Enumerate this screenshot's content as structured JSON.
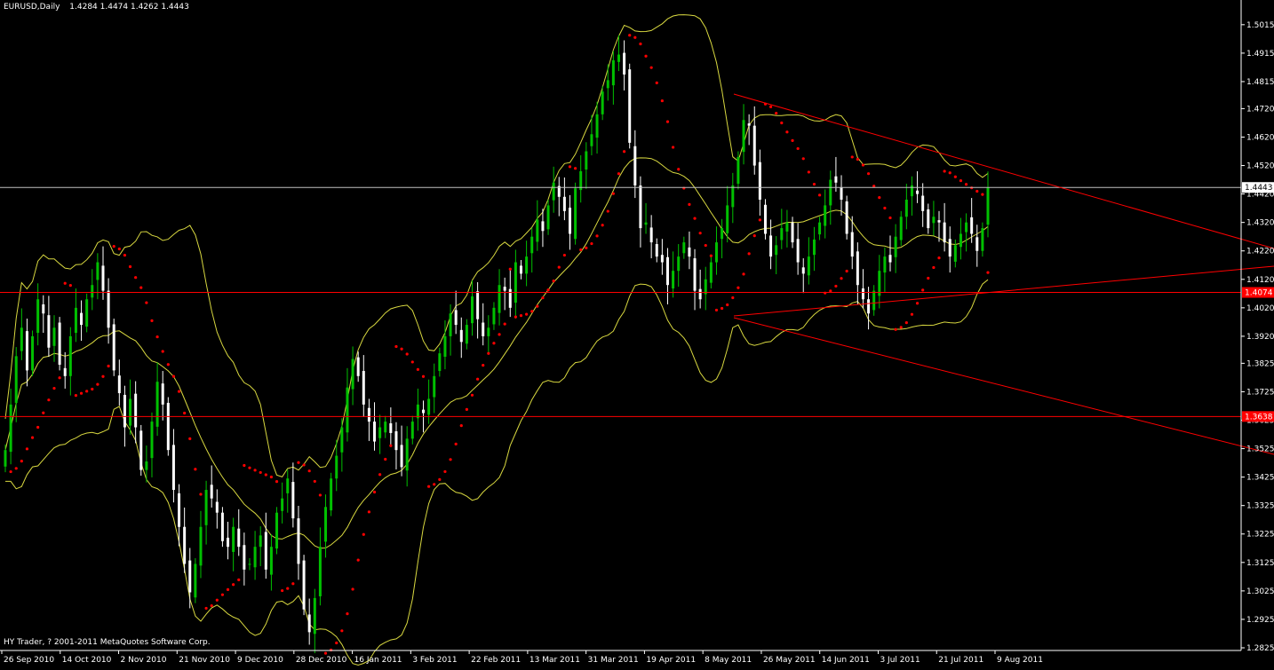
{
  "header": {
    "symbol": "EURUSD,Daily",
    "ohlc": "1.4284 1.4474 1.4262 1.4443"
  },
  "footer": {
    "copyright": "HY Trader, ? 2001-2011 MetaQuotes Software Corp."
  },
  "colors": {
    "background": "#000000",
    "axis": "#ffffff",
    "bull_candle": "#00c000",
    "bear_candle": "#ffffff",
    "bollinger": "#d8d840",
    "psar": "#ff0000",
    "trendline": "#ff0000",
    "hline": "#ff0000",
    "price_line": "#c0c0c0"
  },
  "price_labels": {
    "current": "1.4443",
    "support_upper": "1.4074",
    "support_lower": "1.3638"
  },
  "chart_data": {
    "type": "candlestick",
    "title": "EURUSD,Daily",
    "y_ticks": [
      "1.5015",
      "1.4915",
      "1.4815",
      "1.4720",
      "1.4620",
      "1.4520",
      "1.4420",
      "1.4320",
      "1.4220",
      "1.4120",
      "1.4020",
      "1.3920",
      "1.3825",
      "1.3725",
      "1.3625",
      "1.3525",
      "1.3425",
      "1.3325",
      "1.3225",
      "1.3125",
      "1.3025",
      "1.2925",
      "1.2825"
    ],
    "x_ticks": [
      "26 Sep 2010",
      "14 Oct 2010",
      "2 Nov 2010",
      "21 Nov 2010",
      "9 Dec 2010",
      "28 Dec 2010",
      "16 Jan 2011",
      "3 Feb 2011",
      "22 Feb 2011",
      "13 Mar 2011",
      "31 Mar 2011",
      "19 Apr 2011",
      "8 May 2011",
      "26 May 2011",
      "14 Jun 2011",
      "3 Jul 2011",
      "21 Jul 2011",
      "9 Aug 2011"
    ],
    "ylim": [
      1.2825,
      1.5055
    ],
    "current_price": 1.4443,
    "horizontal_lines": [
      1.4074,
      1.3638
    ],
    "indicators": [
      "Bollinger Bands",
      "Parabolic SAR"
    ],
    "close_path": [
      1.352,
      1.368,
      1.385,
      1.395,
      1.38,
      1.392,
      1.405,
      1.4,
      1.388,
      1.395,
      1.382,
      1.378,
      1.392,
      1.402,
      1.396,
      1.405,
      1.41,
      1.418,
      1.408,
      1.395,
      1.38,
      1.372,
      1.36,
      1.37,
      1.36,
      1.345,
      1.348,
      1.362,
      1.376,
      1.368,
      1.352,
      1.338,
      1.325,
      1.312,
      1.302,
      1.312,
      1.325,
      1.338,
      1.335,
      1.33,
      1.32,
      1.318,
      1.325,
      1.318,
      1.31,
      1.312,
      1.318,
      1.322,
      1.31,
      1.318,
      1.33,
      1.335,
      1.342,
      1.328,
      1.312,
      1.296,
      1.288,
      1.3,
      1.318,
      1.332,
      1.342,
      1.35,
      1.36,
      1.374,
      1.384,
      1.378,
      1.368,
      1.362,
      1.355,
      1.36,
      1.362,
      1.358,
      1.352,
      1.346,
      1.356,
      1.362,
      1.368,
      1.365,
      1.37,
      1.378,
      1.386,
      1.392,
      1.4,
      1.396,
      1.39,
      1.396,
      1.406,
      1.398,
      1.392,
      1.395,
      1.402,
      1.41,
      1.408,
      1.402,
      1.418,
      1.414,
      1.42,
      1.427,
      1.433,
      1.429,
      1.438,
      1.446,
      1.441,
      1.436,
      1.428,
      1.444,
      1.45,
      1.457,
      1.463,
      1.47,
      1.478,
      1.482,
      1.489,
      1.491,
      1.484,
      1.46,
      1.445,
      1.43,
      1.432,
      1.425,
      1.42,
      1.418,
      1.41,
      1.415,
      1.42,
      1.425,
      1.42,
      1.408,
      1.405,
      1.412,
      1.418,
      1.425,
      1.43,
      1.438,
      1.445,
      1.455,
      1.468,
      1.466,
      1.452,
      1.44,
      1.428,
      1.42,
      1.424,
      1.43,
      1.432,
      1.425,
      1.418,
      1.414,
      1.42,
      1.426,
      1.432,
      1.438,
      1.447,
      1.446,
      1.44,
      1.428,
      1.42,
      1.41,
      1.405,
      1.4,
      1.408,
      1.415,
      1.42,
      1.418,
      1.427,
      1.434,
      1.44,
      1.445,
      1.442,
      1.436,
      1.43,
      1.434,
      1.432,
      1.425,
      1.42,
      1.424,
      1.428,
      1.432,
      1.428,
      1.422,
      1.43,
      1.4443
    ]
  }
}
